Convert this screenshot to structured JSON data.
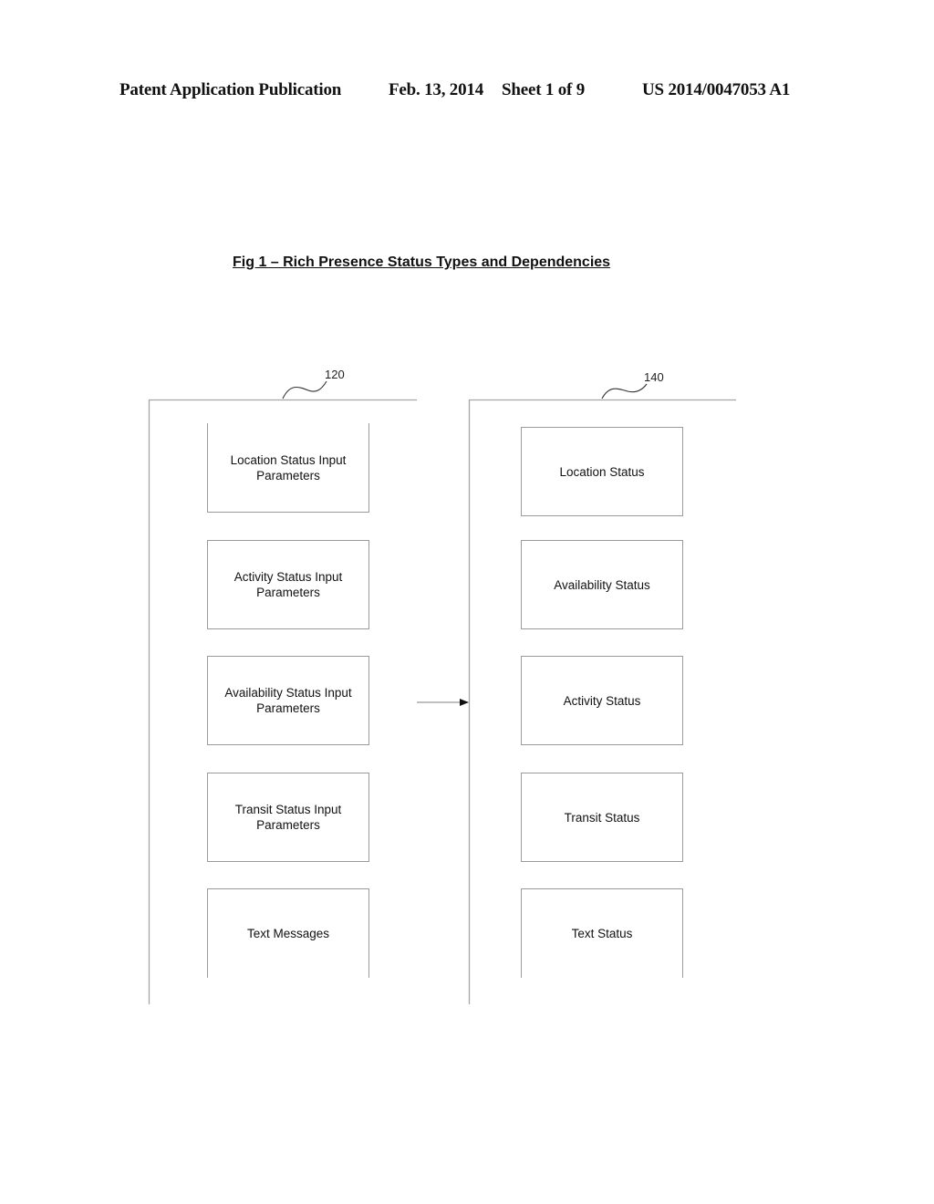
{
  "header": {
    "publication": "Patent Application Publication",
    "date": "Feb. 13, 2014",
    "sheet": "Sheet 1 of 9",
    "number": "US 2014/0047053 A1"
  },
  "figure": {
    "title": "Fig 1 – Rich Presence Status Types and Dependencies"
  },
  "groups": {
    "inputs": {
      "ref": "120",
      "boxes": [
        "Location Status Input Parameters",
        "Activity Status Input Parameters",
        "Availability Status Input Parameters",
        "Transit Status Input Parameters",
        "Text Messages"
      ]
    },
    "statuses": {
      "ref": "140",
      "boxes": [
        "Location Status",
        "Availability Status",
        "Activity Status",
        "Transit Status",
        "Text Status"
      ]
    }
  },
  "connections": [
    {
      "from": "inputs",
      "to": "statuses",
      "type": "arrow"
    }
  ]
}
